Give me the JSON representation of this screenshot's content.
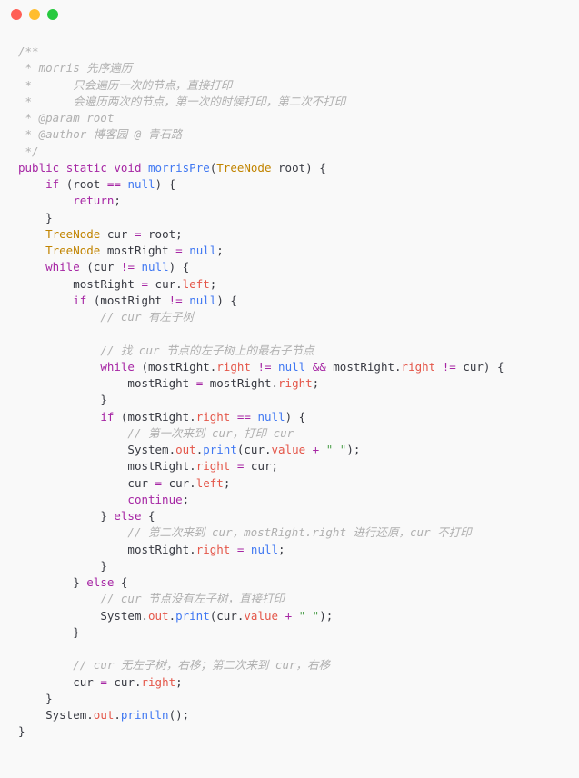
{
  "comments": {
    "c1": "/**",
    "c2": " * morris 先序遍历",
    "c3": " *      只会遍历一次的节点，直接打印",
    "c4": " *      会遍历两次的节点，第一次的时候打印，第二次不打印",
    "c5": " * @param root",
    "c6": " * @author 博客园 @ 青石路",
    "c7": " */",
    "c8": "// cur 有左子树",
    "c9": "// 找 cur 节点的左子树上的最右子节点",
    "c10": "// 第一次来到 cur，打印 cur",
    "c11": "// 第二次来到 cur，mostRight.right 进行还原，cur 不打印",
    "c12": "// cur 节点没有左子树，直接打印",
    "c13": "// cur 无左子树，右移；第二次来到 cur，右移"
  },
  "kw": {
    "public": "public",
    "static": "static",
    "void": "void",
    "if": "if",
    "return": "return",
    "while": "while",
    "else": "else",
    "continue": "continue",
    "null": "null"
  },
  "types": {
    "TreeNode": "TreeNode"
  },
  "names": {
    "morrisPre": "morrisPre",
    "root": "root",
    "cur": "cur",
    "mostRight": "mostRight",
    "left": "left",
    "right": "right",
    "System": "System",
    "out": "out",
    "print": "print",
    "println": "println",
    "value": "value"
  },
  "ops": {
    "eqeq": "==",
    "neq": "!=",
    "assign": "=",
    "andand": "&&",
    "plus": "+"
  },
  "punct": {
    "lparen": "(",
    "rparen": ")",
    "lbrace": "{",
    "rbrace": "}",
    "semi": ";",
    "dot": "."
  },
  "strings": {
    "space": "\" \""
  }
}
